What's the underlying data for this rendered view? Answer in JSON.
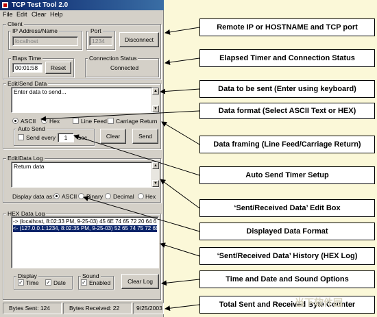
{
  "window": {
    "title": "TCP Test Tool 2.0",
    "menu": [
      "File",
      "Edit",
      "Clear",
      "Help"
    ]
  },
  "client": {
    "legend": "Client",
    "ip_label": "IP Address/Name",
    "ip_value": "localhost",
    "port_label": "Port",
    "port_value": "1234",
    "disconnect_label": "Disconnect"
  },
  "elapse": {
    "legend": "Elaps Time",
    "value": "00:01:58",
    "reset_label": "Reset"
  },
  "connection": {
    "legend": "Connection Status",
    "value": "Connected"
  },
  "send": {
    "legend": "Edit/Send Data",
    "text": "Enter data to send...",
    "ascii_label": "ASCII",
    "hex_label": "Hex",
    "linefeed_label": "Line Feed",
    "cr_label": "Carriage Return",
    "autosend_legend": "Auto Send",
    "send_every_label": "Send every",
    "interval_value": "1",
    "sec_label": "sec.",
    "clear_label": "Clear",
    "send_label": "Send"
  },
  "datalog": {
    "legend": "Edit/Data Log",
    "text": "Return data",
    "display_as_label": "Display data as:",
    "ascii_label": "ASCII",
    "binary_label": "Binary",
    "decimal_label": "Decimal",
    "hex_label": "Hex"
  },
  "hexlog": {
    "legend": "HEX Data Log",
    "lines": [
      "-> (localhost, 8:02:33 PM, 9-25-03) 45 6E 74 65 72 20 64 61",
      "<- (127.0.0.1:1234, 8:02:35 PM, 9-25-03) 52 65 74 75 72 6E"
    ]
  },
  "display": {
    "legend": "Display",
    "time_label": "Time",
    "date_label": "Date"
  },
  "sound": {
    "legend": "Sound",
    "enabled_label": "Enabled"
  },
  "clearlog_label": "Clear Log",
  "status": {
    "bytes_sent": "Bytes Sent: 124",
    "bytes_received": "Bytes Received: 22",
    "date": "9/25/2003"
  },
  "callouts": [
    "Remote IP or HOSTNAME and TCP port",
    "Elapsed Timer and Connection Status",
    "Data to be sent  (Enter using keyboard)",
    "Data format (Select ASCII Text or HEX)",
    "Data framing (Line Feed/Carriage Return)",
    "Auto Send Timer Setup",
    "‘Sent/Received Data’ Edit Box",
    "Displayed Data Format",
    "‘Sent/Received Data’ History (HEX Log)",
    "Time and Date and Sound Options",
    "Total Sent and Received Byte Counter"
  ],
  "watermark": "当下软件园"
}
